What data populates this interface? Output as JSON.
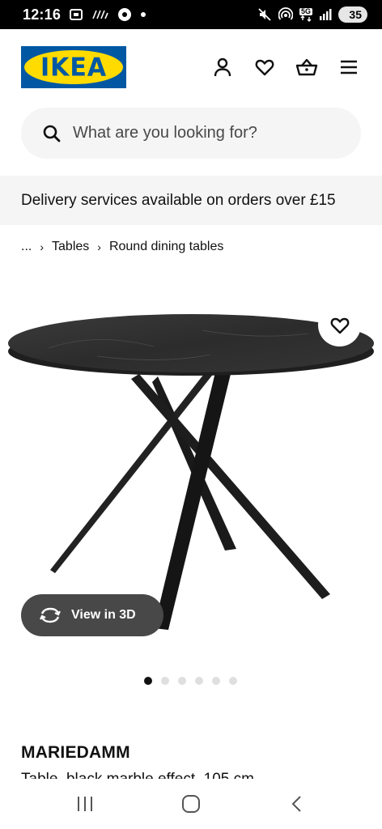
{
  "status_bar": {
    "time": "12:16",
    "battery": "35",
    "network": "5G"
  },
  "header": {
    "logo_text": "IKEA",
    "icons": [
      "account-icon",
      "heart-icon",
      "basket-icon",
      "menu-icon"
    ]
  },
  "search": {
    "placeholder": "What are you looking for?"
  },
  "delivery_banner": "Delivery services available on orders over £15",
  "breadcrumb": {
    "ellipsis": "...",
    "items": [
      "Tables",
      "Round dining tables"
    ]
  },
  "product": {
    "view_3d_label": "View in 3D",
    "name": "MARIEDAMM",
    "description": "Table, black marble effect, 105 cm",
    "image_count": 6,
    "active_image": 1
  },
  "colors": {
    "ikea_blue": "#0058a3",
    "ikea_yellow": "#ffdb00",
    "banner_bg": "#f5f5f5",
    "button_dark": "#484848"
  }
}
